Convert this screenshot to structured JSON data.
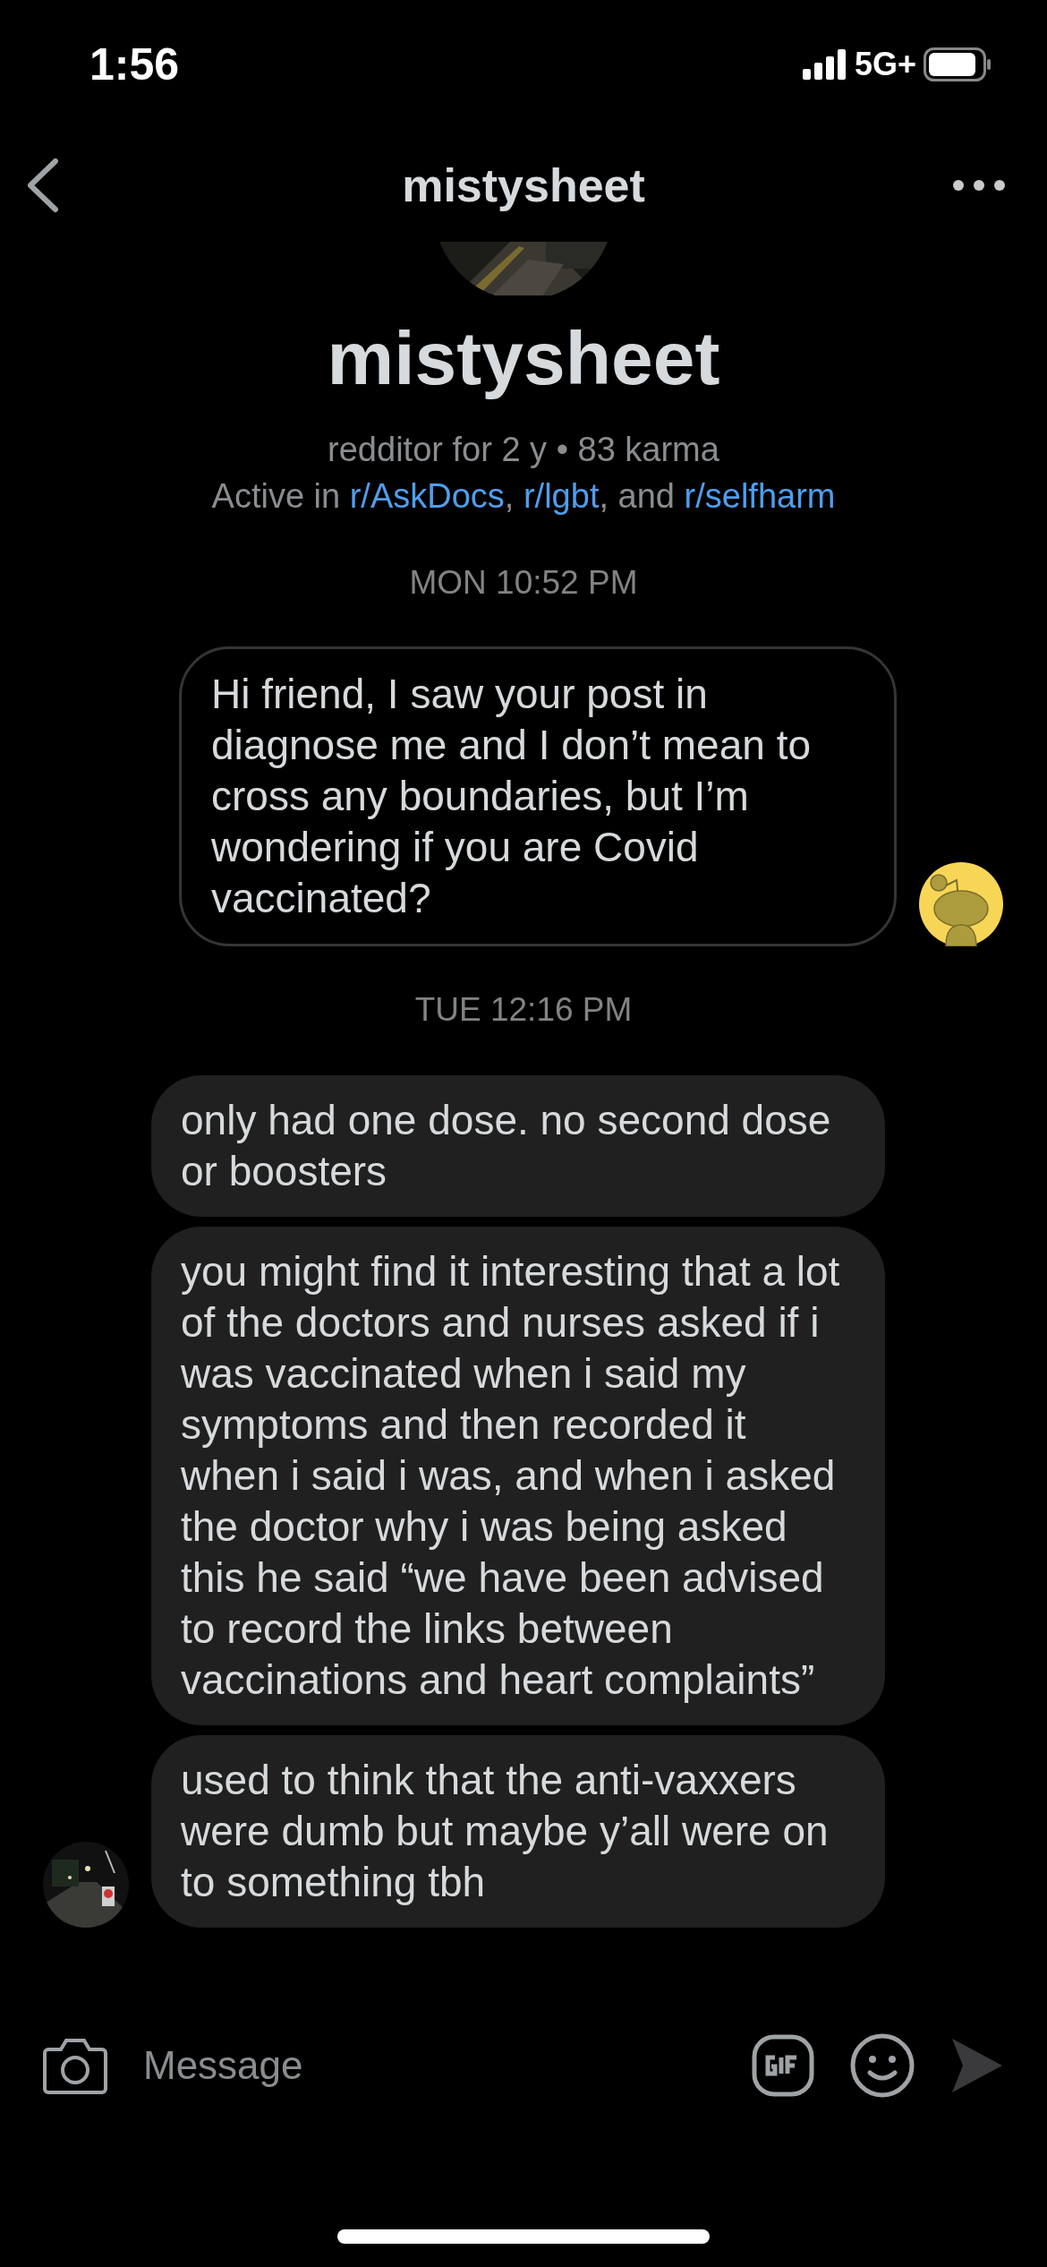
{
  "status_bar": {
    "time": "1:56",
    "network": "5G+"
  },
  "header": {
    "title": "mistysheet"
  },
  "profile": {
    "kind": "picture",
    "name": "mistysheet",
    "stats": "redditor for 2 y • 83 karma",
    "active_in": [
      {
        "kind": "plain",
        "text": "Active in "
      },
      {
        "kind": "link",
        "text": "r/AskDocs",
        "suffix": ", "
      },
      {
        "kind": "link",
        "text": "r/lgbt",
        "suffix": ", "
      },
      {
        "kind": "plain",
        "text": "and "
      },
      {
        "kind": "link",
        "text": "r/selfharm"
      }
    ]
  },
  "thread": [
    {
      "kind": "timestamp",
      "text": "MON 10:52 PM"
    },
    {
      "kind": "outgoing",
      "text": "Hi friend, I saw your post in diagnose me  and I don’t mean to cross any boundaries, but I’m wondering if you are Covid vaccinated?"
    },
    {
      "kind": "timestamp",
      "text": "TUE 12:16 PM"
    },
    {
      "kind": "incoming",
      "text": "only had one dose. no second dose or boosters"
    },
    {
      "kind": "incoming",
      "text": "you might find it interesting that a lot of the doctors and nurses asked if i was vaccinated when i said my symptoms and then recorded it when i said i was, and when i asked the doctor why i was being asked this he said “we have been advised to record the links between vaccinations and heart complaints”"
    },
    {
      "kind": "incoming",
      "text": "used to think that the anti-vaxxers were dumb but maybe y’all were on to something tbh"
    }
  ],
  "composer": {
    "placeholder": "Message"
  }
}
